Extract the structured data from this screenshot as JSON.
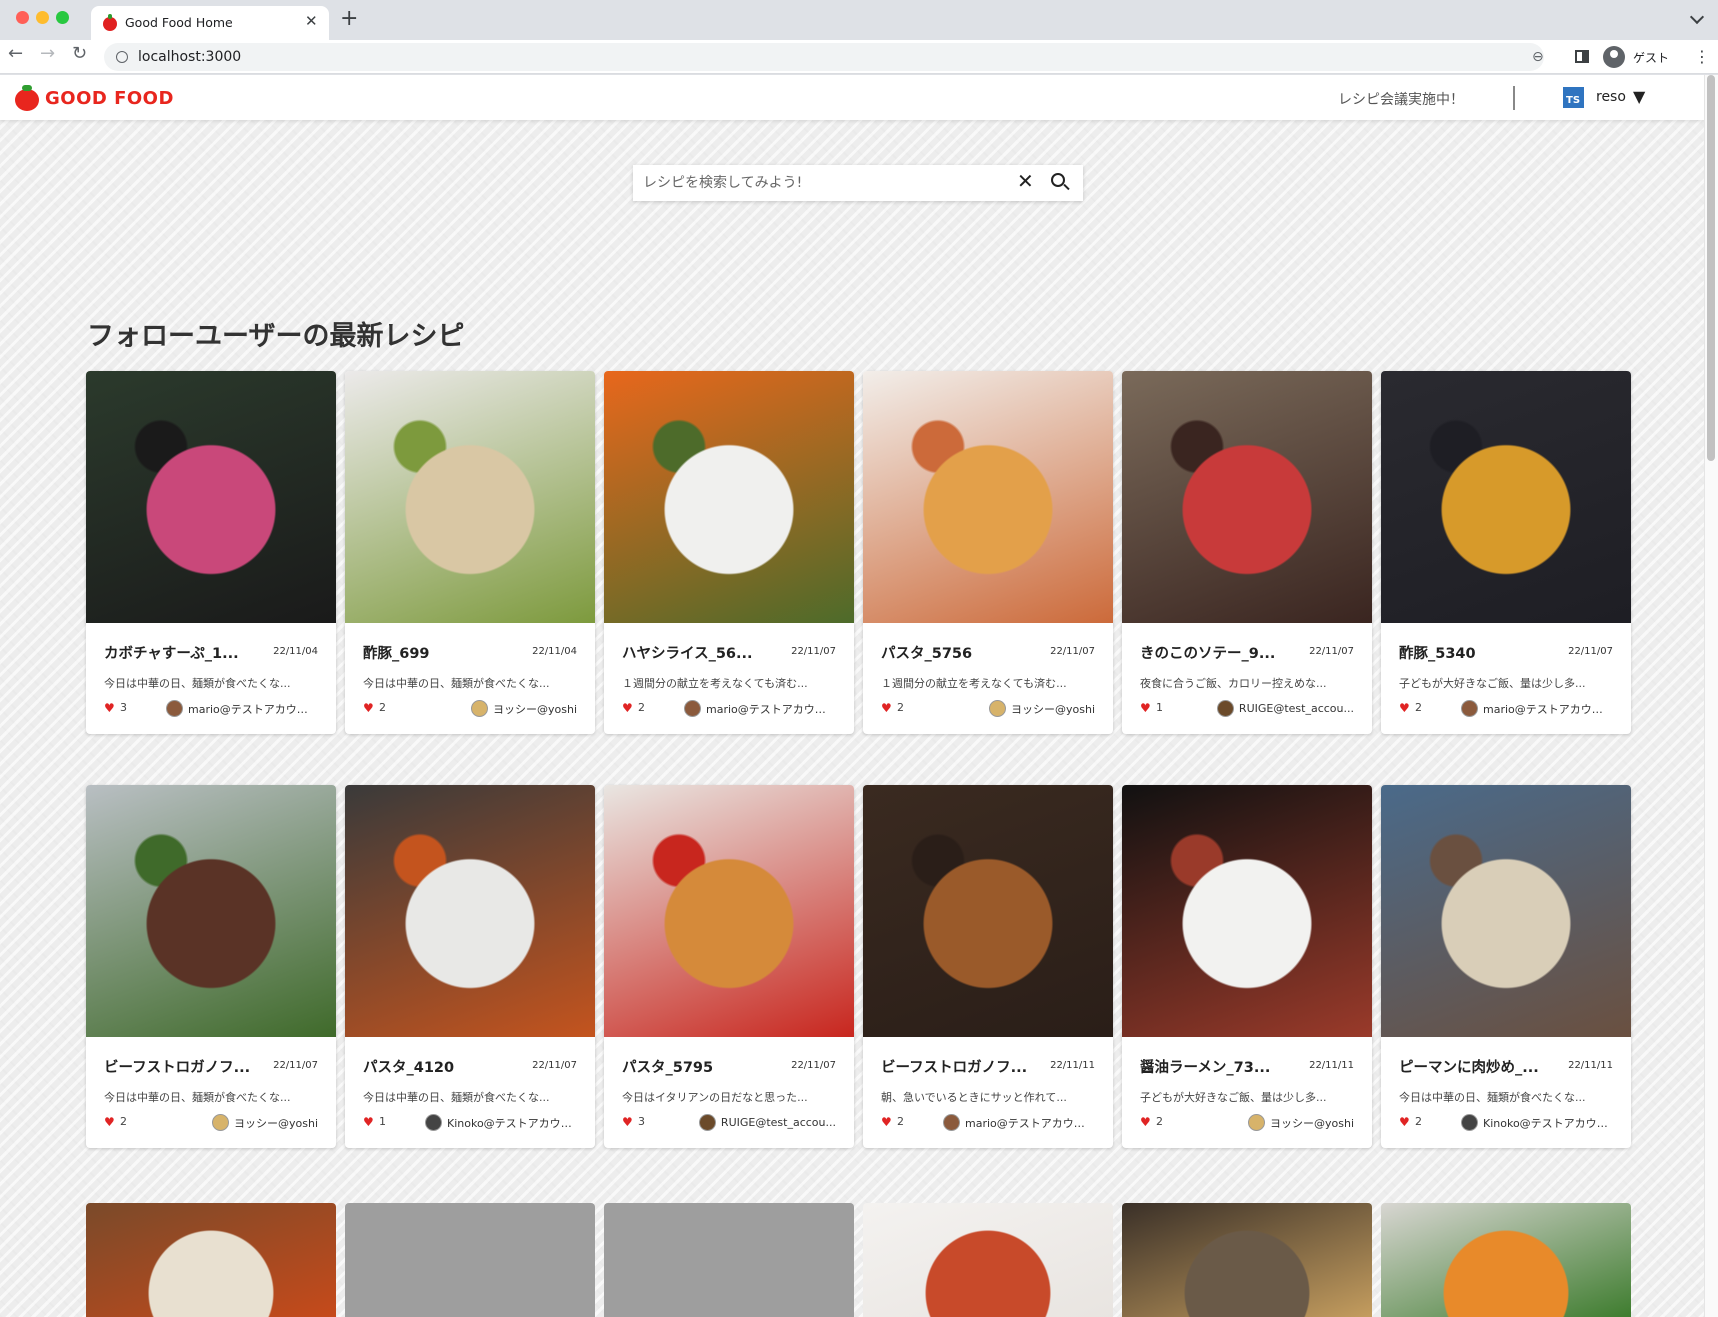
{
  "browser": {
    "tab_title": "Good Food Home",
    "close_tab_glyph": "✕",
    "new_tab_glyph": "+",
    "url": "localhost:3000",
    "profile_label": "ゲスト",
    "back_glyph": "←",
    "forward_glyph": "→",
    "reload_glyph": "↻",
    "menu_glyph": "⋮",
    "zoom_glyph": "⊖"
  },
  "header": {
    "logo_text": "GOOD FOOD",
    "meeting_text": "レシピ会議実施中！",
    "user_badge": "TS",
    "user_name": "reso",
    "user_caret": "▼"
  },
  "search": {
    "placeholder": "レシピを検索してみよう!",
    "clear_glyph": "✕"
  },
  "section_title": "フォローユーザーの最新レシピ",
  "colors": {
    "brand_red": "#e8261e",
    "heart": "#e02424",
    "badge_blue": "#2f74c0"
  },
  "recipes": [
    {
      "name": "カボチャすーぷ_1...",
      "date": "22/11/04",
      "desc": "今日は中華の日、麺類が食べたくな...",
      "likes": "3",
      "author": "mario@テストアカウント",
      "avatar_color": "#8b5a3c",
      "img_colors": [
        "#2b3a2c",
        "#c9487a",
        "#1a1a1a"
      ]
    },
    {
      "name": "酢豚_699",
      "date": "22/11/04",
      "desc": "今日は中華の日、麺類が食べたくな...",
      "likes": "2",
      "author": "ヨッシー@yoshi",
      "avatar_color": "#d7b36a",
      "img_colors": [
        "#eceaea",
        "#d9c7a4",
        "#7d9a3d"
      ]
    },
    {
      "name": "ハヤシライス_56...",
      "date": "22/11/07",
      "desc": "１週間分の献立を考えなくても済む...",
      "likes": "2",
      "author": "mario@テストアカウント",
      "avatar_color": "#8b5a3c",
      "img_colors": [
        "#e8671c",
        "#f0f0ee",
        "#4d6b2a"
      ]
    },
    {
      "name": "パスタ_5756",
      "date": "22/11/07",
      "desc": "１週間分の献立を考えなくても済む...",
      "likes": "2",
      "author": "ヨッシー@yoshi",
      "avatar_color": "#d7b36a",
      "img_colors": [
        "#f2eeea",
        "#e3a04a",
        "#cc6a3a"
      ]
    },
    {
      "name": "きのこのソテー_9...",
      "date": "22/11/07",
      "desc": "夜食に合うご飯、カロリー控えめな...",
      "likes": "1",
      "author": "RUIGE@test_accou...",
      "avatar_color": "#6b4a2a",
      "img_colors": [
        "#7a6a5a",
        "#c83a3a",
        "#3a2520"
      ]
    },
    {
      "name": "酢豚_5340",
      "date": "22/11/07",
      "desc": "子どもが大好きなご飯、量は少し多...",
      "likes": "2",
      "author": "mario@テストアカウント",
      "avatar_color": "#8b5a3c",
      "img_colors": [
        "#2a2a30",
        "#d79a2a",
        "#1e1e24"
      ]
    },
    {
      "name": "ビーフストロガノフ...",
      "date": "22/11/07",
      "desc": "今日は中華の日、麺類が食べたくな...",
      "likes": "2",
      "author": "ヨッシー@yoshi",
      "avatar_color": "#d7b36a",
      "img_colors": [
        "#b9bfc3",
        "#5a3326",
        "#3f6a2a"
      ]
    },
    {
      "name": "パスタ_4120",
      "date": "22/11/07",
      "desc": "今日は中華の日、麺類が食べたくな...",
      "likes": "1",
      "author": "Kinoko@テストアカウント",
      "avatar_color": "#444444",
      "img_colors": [
        "#3a3a3a",
        "#e8e8e6",
        "#c4541e"
      ]
    },
    {
      "name": "パスタ_5795",
      "date": "22/11/07",
      "desc": "今日はイタリアンの日だなと思った...",
      "likes": "3",
      "author": "RUIGE@test_accou...",
      "avatar_color": "#6b4a2a",
      "img_colors": [
        "#e9e6e2",
        "#d58a3a",
        "#c8261e"
      ]
    },
    {
      "name": "ビーフストロガノフ...",
      "date": "22/11/11",
      "desc": "朝、急いでいるときにサッと作れて...",
      "likes": "2",
      "author": "mario@テストアカウント",
      "avatar_color": "#8b5a3c",
      "img_colors": [
        "#3a2a20",
        "#9a5a2a",
        "#2a1e18"
      ]
    },
    {
      "name": "醤油ラーメン_73...",
      "date": "22/11/11",
      "desc": "子どもが大好きなご飯、量は少し多...",
      "likes": "2",
      "author": "ヨッシー@yoshi",
      "avatar_color": "#d7b36a",
      "img_colors": [
        "#111111",
        "#f2f2f0",
        "#9a3a2a"
      ]
    },
    {
      "name": "ピーマンに肉炒め_...",
      "date": "22/11/11",
      "desc": "今日は中華の日、麺類が食べたくな...",
      "likes": "2",
      "author": "Kinoko@テストアカウント",
      "avatar_color": "#444444",
      "img_colors": [
        "#4a6a8a",
        "#d9ceb8",
        "#6a5040"
      ]
    }
  ],
  "partial_row": [
    {
      "img_colors": [
        "#7a4a2a",
        "#e8e0d0",
        "#c84a1a"
      ]
    },
    {
      "img_colors": [
        "#9e9e9e",
        "#9e9e9e",
        "#9e9e9e"
      ]
    },
    {
      "img_colors": [
        "#9e9e9e",
        "#9e9e9e",
        "#9e9e9e"
      ]
    },
    {
      "img_colors": [
        "#f4f2f0",
        "#c84a2a",
        "#e8e4e0"
      ]
    },
    {
      "img_colors": [
        "#3a3028",
        "#6a5a48",
        "#c8a060"
      ]
    },
    {
      "img_colors": [
        "#d8d6d2",
        "#e88a2a",
        "#3a7a2a"
      ]
    }
  ]
}
